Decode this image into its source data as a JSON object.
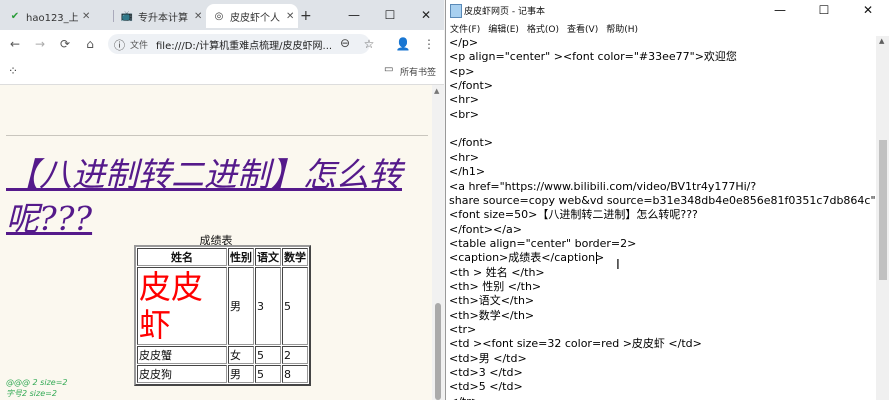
{
  "browser": {
    "tabs": [
      {
        "label": "hao123_上",
        "icon": "✔",
        "icon_color": "#2a9d3a"
      },
      {
        "label": "专升本计算",
        "icon": "📺",
        "icon_color": "#00a1d6"
      },
      {
        "label": "皮皮虾个人",
        "icon": "◎",
        "icon_color": "#444444"
      }
    ],
    "new_tab": "+",
    "window_controls": {
      "minimize": "—",
      "maximize": "☐",
      "close": "✕"
    },
    "toolbar": {
      "back": "←",
      "forward": "→",
      "reload": "⟳",
      "home": "⌂",
      "info": "ⓘ",
      "protocol_label": "文件",
      "url": "file:///D:/计算机重难点梳理/皮皮虾网...",
      "zoom": "⊖",
      "star": "☆",
      "profile": "👤",
      "menu": "⋮"
    },
    "bookmarks": {
      "apps": "⁘",
      "folder": "▭",
      "all_bookmarks": "所有书签"
    },
    "page": {
      "heading": "【八进制转二进制】怎么转呢???",
      "caption": "成绩表",
      "headers": [
        "姓名",
        "性别",
        "语文",
        "数学"
      ],
      "rows": [
        [
          "皮皮虾",
          "男",
          "3",
          "5"
        ],
        [
          "皮皮蟹",
          "女",
          "5",
          "2"
        ],
        [
          "皮皮狗",
          "男",
          "5",
          "8"
        ]
      ],
      "green_line1": "@@@ 2 size=2",
      "green_line2": "字号2 size=2",
      "scroll_up": "▲"
    }
  },
  "notepad": {
    "title": "皮皮虾网页 - 记事本",
    "window_controls": {
      "minimize": "—",
      "maximize": "☐",
      "close": "✕"
    },
    "menu": [
      "文件(F)",
      "编辑(E)",
      "格式(O)",
      "查看(V)",
      "帮助(H)"
    ],
    "lines": [
      "</p>",
      "<p align=\"center\" ><font color=\"#33ee77\">欢迎您",
      "<p>",
      "</font>",
      "<hr>",
      "<br>",
      "",
      "</font>",
      "<hr>",
      "</h1>",
      "<a href=\"https://www.bilibili.com/video/BV1tr4y177Hi/?",
      "share source=copy web&vd source=b31e348db4e0e856e81f0351c7db864c\"",
      "<font size=50>【八进制转二进制】怎么转呢???",
      "</font></a>",
      "<table align=\"center\" border=2>",
      "<caption>成绩表</caption>",
      "<th > 姓名 </th>",
      "<th> 性别 </th>",
      "<th>语文</th>",
      "<th>数学</th>",
      "<tr>",
      "<td ><font size=32 color=red >皮皮虾 </td>",
      "<td>男 </td>",
      "<td>3 </td>",
      "<td>5 </td>",
      "</tr>"
    ],
    "scroll_up": "▲"
  }
}
